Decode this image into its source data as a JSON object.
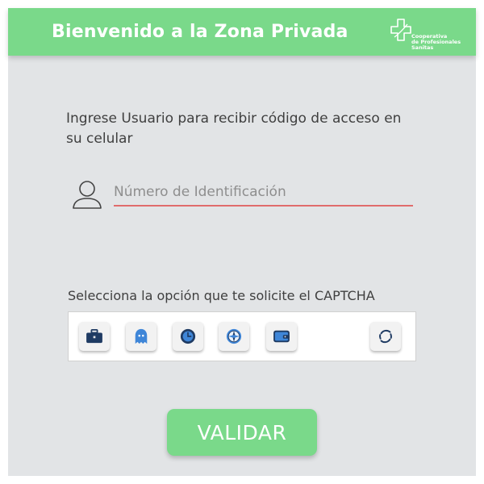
{
  "header": {
    "title": "Bienvenido a la Zona Privada",
    "logo": {
      "line1": "Cooperativa",
      "line2": "de Profesionales",
      "line3": "Sanitas"
    }
  },
  "intro_text": "Ingrese Usuario para recibir código de acceso en su celular",
  "id_field": {
    "placeholder": "Número de Identificación",
    "value": ""
  },
  "captcha": {
    "label": "Selecciona la opción que te solicite el CAPTCHA",
    "options": [
      {
        "icon": "briefcase-icon"
      },
      {
        "icon": "ghost-icon"
      },
      {
        "icon": "clock-icon"
      },
      {
        "icon": "compass-icon"
      },
      {
        "icon": "wallet-icon"
      }
    ],
    "refresh_icon": "refresh-icon"
  },
  "validate_label": "VALIDAR",
  "colors": {
    "brand_green": "#7ad98a",
    "panel_gray": "#e2e4e6",
    "field_underline": "#e06c6c",
    "icon_navy": "#1f3b63",
    "icon_blue": "#3f86d8"
  }
}
